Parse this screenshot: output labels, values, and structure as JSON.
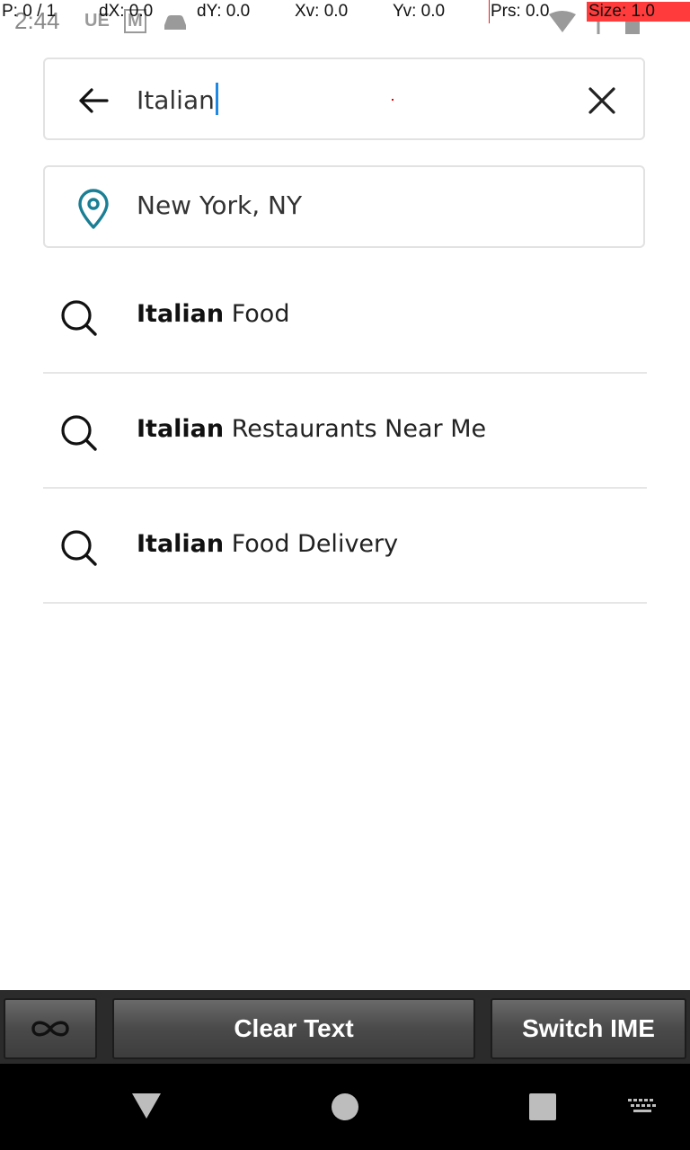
{
  "status_bar": {
    "time": "2:44",
    "notif_icons": [
      "UE",
      "M"
    ],
    "overlay": {
      "p": "P: 0 / 1",
      "dx": "dX: 0.0",
      "dy": "dY: 0.0",
      "xv": "Xv: 0.0",
      "yv": "Yv: 0.0",
      "prs": "Prs: 0.0",
      "size": "Size: 1.0"
    }
  },
  "search": {
    "query": "Italian",
    "location": "New York, NY"
  },
  "suggestions": [
    {
      "bold": "Italian",
      "rest": " Food"
    },
    {
      "bold": "Italian",
      "rest": " Restaurants Near Me"
    },
    {
      "bold": "Italian",
      "rest": " Food Delivery"
    }
  ],
  "ime_bar": {
    "clear_label": "Clear Text",
    "switch_label": "Switch IME"
  },
  "colors": {
    "pin_accent": "#1a7f94",
    "caret": "#1e88e5"
  }
}
